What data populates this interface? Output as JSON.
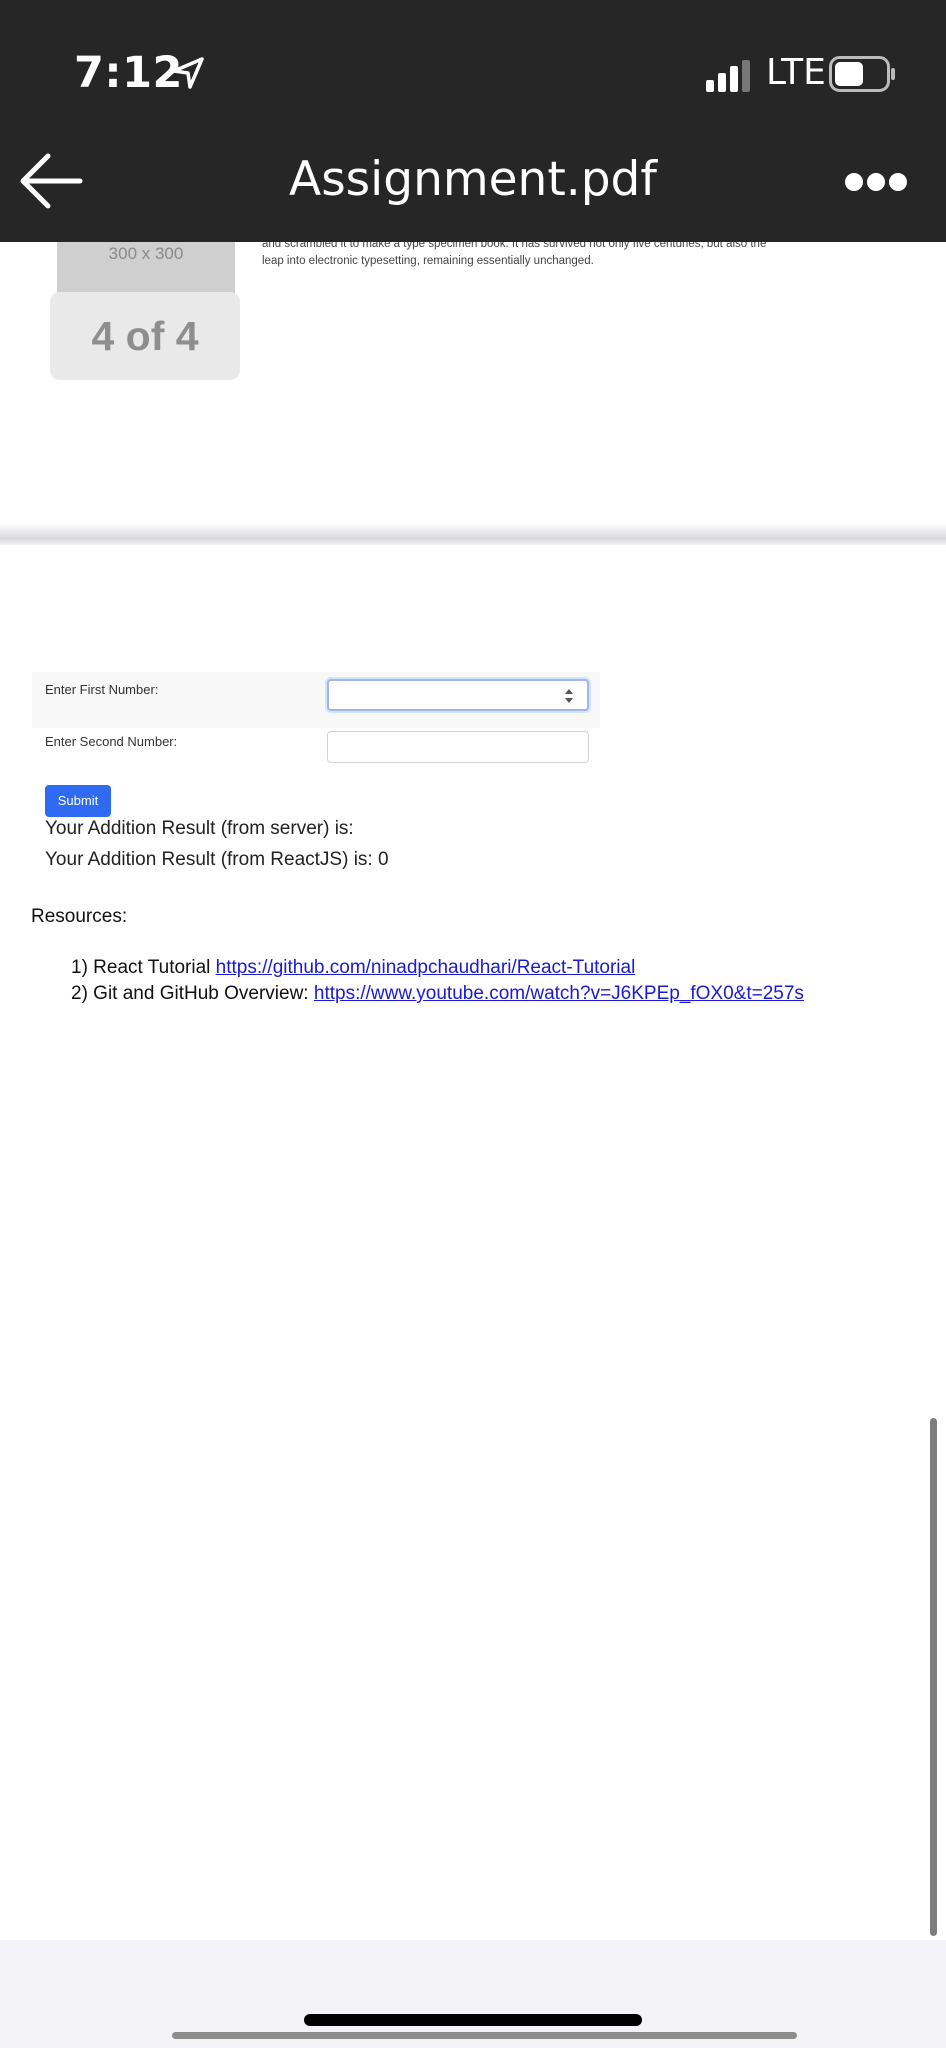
{
  "status_bar": {
    "time": "7:12",
    "network": "LTE"
  },
  "nav": {
    "title": "Assignment.pdf"
  },
  "pdf": {
    "thumb_label": "300 x 300",
    "body_text_line1": "and scrambled it to make a type specimen book. It has survived not only five centuries, but also the",
    "body_text_line2": "leap into electronic typesetting, remaining essentially unchanged.",
    "page_indicator": "4 of 4"
  },
  "form": {
    "first_label": "Enter First Number:",
    "second_label": "Enter Second Number:",
    "first_value": "",
    "second_value": "",
    "submit_label": "Submit",
    "result_server": "Your Addition Result (from server) is:",
    "result_react": "Your Addition Result (from ReactJS) is: 0",
    "accent_color": "#2f6bf2"
  },
  "resources": {
    "heading": "Resources:",
    "items": [
      {
        "prefix": "1) React Tutorial ",
        "link": "https://github.com/ninadpchaudhari/React-Tutorial"
      },
      {
        "prefix": "2) Git and GitHub Overview: ",
        "link": "https://www.youtube.com/watch?v=J6KPEp_fOX0&t=257s"
      }
    ]
  },
  "icons": {
    "location": "location-arrow-icon",
    "signal": "signal-bars-icon",
    "battery": "battery-icon",
    "back": "back-arrow-icon",
    "more": "more-dots-icon"
  }
}
